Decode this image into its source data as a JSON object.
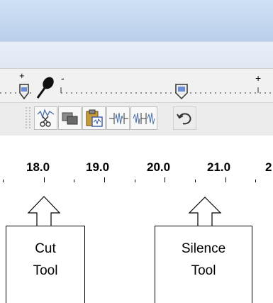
{
  "ruler": {
    "labels": [
      "18.0",
      "19.0",
      "20.0",
      "21.0",
      "2"
    ]
  },
  "toolbar": {
    "buttons": [
      {
        "name": "cut-button",
        "icon": "scissors-icon"
      },
      {
        "name": "copy-button",
        "icon": "copy-icon"
      },
      {
        "name": "paste-button",
        "icon": "clipboard-icon"
      },
      {
        "name": "trim-button",
        "icon": "trim-audio-icon"
      },
      {
        "name": "silence-button",
        "icon": "silence-audio-icon"
      },
      {
        "name": "undo-button",
        "icon": "undo-icon"
      }
    ]
  },
  "meters": {
    "minus_label": "-",
    "plus_label": "+",
    "left_plus_label": "+"
  },
  "callouts": {
    "cut": "Cut Tool",
    "silence": "Silence Tool",
    "cut_line1": "Cut",
    "cut_line2": "Tool",
    "silence_line1": "Silence",
    "silence_line2": "Tool"
  },
  "colors": {
    "titlebar": "#c4d8f0",
    "toolbar": "#ececec",
    "accent_blue": "#4a6fa8"
  }
}
